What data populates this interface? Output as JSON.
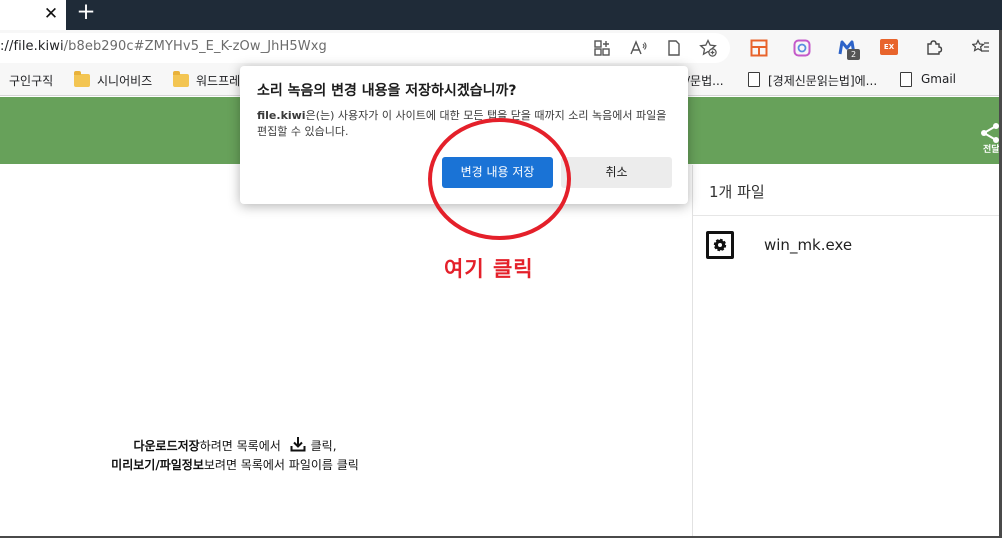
{
  "browser": {
    "tab_close_glyph": "✕",
    "new_tab_glyph": "+",
    "url_host": "://file.kiwi",
    "url_rest": "/b8eb290c#ZMYHv5_E_K-zOw_JhH5Wxg",
    "ext_badge_count": "2",
    "ext_ex_label": "EX"
  },
  "bookmarks": [
    {
      "label": "구인구직",
      "icon": "none"
    },
    {
      "label": "시니어비즈",
      "icon": "folder-icon"
    },
    {
      "label": "워드프레",
      "icon": "folder-icon"
    },
    {
      "label": "/문법...",
      "icon": "none"
    },
    {
      "label": "[경제신문읽는법]에...",
      "icon": "page-icon"
    },
    {
      "label": "Gmail",
      "icon": "page-icon"
    }
  ],
  "site": {
    "share_label": "전달",
    "panel_title": "1개 파일",
    "file_name": "win_mk.exe",
    "instruction_line1_bold": "다운로드저장",
    "instruction_line1_rest": "하려면 목록에서",
    "instruction_line1_end": "클릭,",
    "instruction_line2_bold": "미리보기/파일정보",
    "instruction_line2_rest": "보려면 목록에서 파일이름 클릭"
  },
  "dialog": {
    "title": "소리 녹음의 변경 내용을 저장하시겠습니까?",
    "domain": "file.kiwi",
    "message": "은(는) 사용자가 이 사이트에 대한 모든 탭을 닫을 때까지 소리 녹음에서 파일을 편집할 수 있습니다.",
    "save_label": "변경 내용 저장",
    "cancel_label": "취소"
  },
  "annotation": {
    "text": "여기 클릭"
  },
  "colors": {
    "header_green": "#67a15a",
    "primary_button": "#1a73d6",
    "annotation_red": "#e4202a",
    "tabstrip": "#1f2b38"
  }
}
